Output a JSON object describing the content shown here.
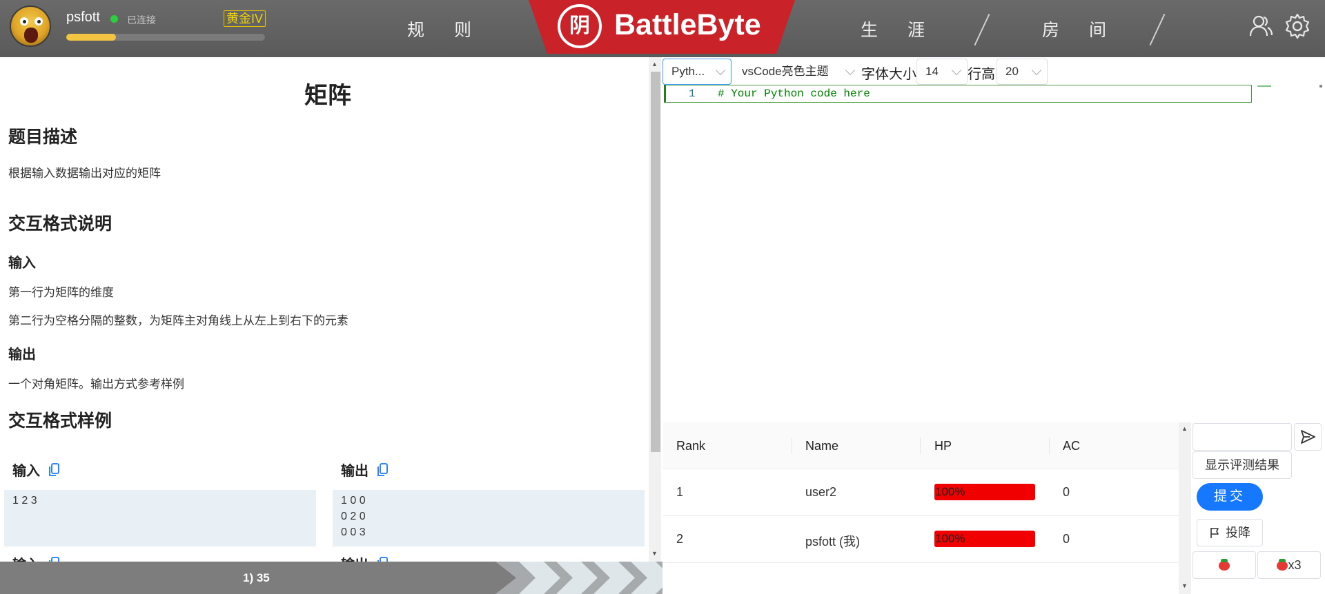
{
  "header": {
    "username": "psfott",
    "connection_status": "已连接",
    "rank_badge": "黄金IV",
    "xp_progress_fraction": 0.25,
    "nav": [
      "规 则",
      "生 涯",
      "房 间"
    ],
    "logo_text": "BattleByte",
    "logo_mark": "阴",
    "icons": [
      "user-avatar",
      "online-status-dot",
      "users-icon",
      "gear-icon"
    ]
  },
  "problem": {
    "title": "矩阵",
    "desc_heading": "题目描述",
    "desc_text": "根据输入数据输出对应的矩阵",
    "format_heading": "交互格式说明",
    "input_heading": "输入",
    "input_line1": "第一行为矩阵的维度",
    "input_line2": "第二行为空格分隔的整数，为矩阵主对角线上从左上到右下的元素",
    "output_heading": "输出",
    "output_text": "一个对角矩阵。输出方式参考样例",
    "samples_heading": "交互格式样例",
    "sample_input_label": "输入",
    "sample_output_label": "输出",
    "sample_input": "1 2 3",
    "sample_output": "1 0 0\n0 2 0\n0 0 3",
    "sample2_input_label": "输入",
    "sample2_output_label": "输出"
  },
  "progress": {
    "label": "1) 35"
  },
  "toolbar": {
    "language": "Pyth...",
    "theme": "vsCode亮色主题",
    "font_size_label": "字体大小",
    "font_size": "14",
    "line_height_label": "行高",
    "line_height": "20"
  },
  "editor": {
    "line_number": "1",
    "code": "# Your Python code here"
  },
  "ranking": {
    "columns": [
      "Rank",
      "Name",
      "HP",
      "AC"
    ],
    "rows": [
      {
        "rank": "1",
        "name": "user2",
        "hp": "100%",
        "ac": "0"
      },
      {
        "rank": "2",
        "name": "psfott (我)",
        "hp": "100%",
        "ac": "0"
      }
    ]
  },
  "controls": {
    "chat_placeholder": "",
    "show_results_label": "显示评测结果",
    "submit_label": "提交",
    "surrender_label": "投降",
    "tomato_count": "x3"
  },
  "colors": {
    "brand_red": "#c92228",
    "accent_blue": "#1677ff",
    "hp_red": "#f00000",
    "rank_gold": "#f3d400"
  }
}
